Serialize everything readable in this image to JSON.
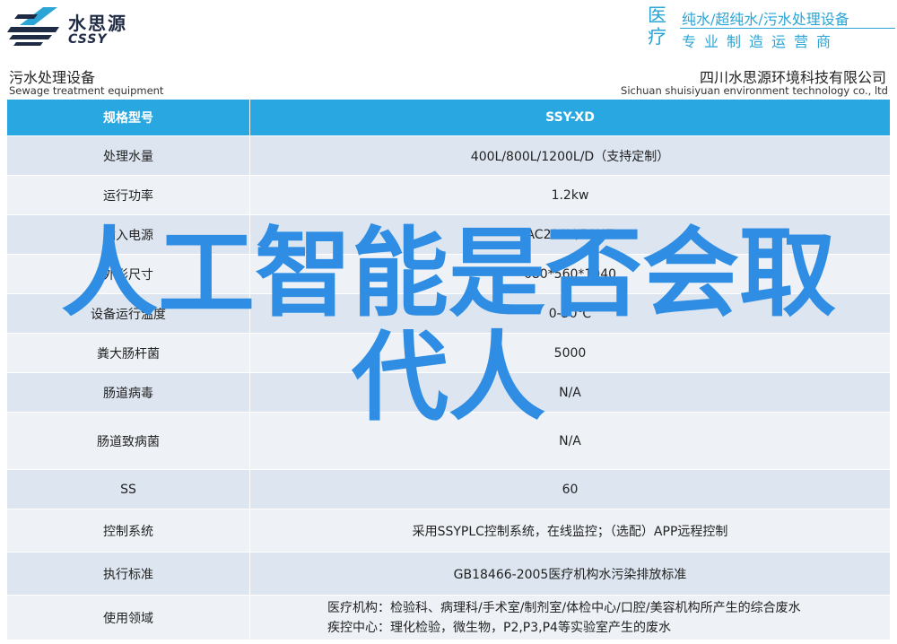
{
  "brand": {
    "name_cn": "水思源",
    "name_en": "CSSY"
  },
  "tagline": {
    "big_chars": "医疗",
    "line1": "纯水/超纯水/污水处理设备",
    "line2": "专业制造运营商"
  },
  "section": {
    "title_cn": "污水处理设备",
    "title_en": "Sewage treatment equipment",
    "company_cn": "四川水思源环境科技有限公司",
    "company_en": "Sichuan shuisiyuan environment technology co., ltd"
  },
  "table": {
    "header": {
      "key": "规格型号",
      "value": "SSY-XD"
    },
    "rows": [
      {
        "key": "处理水量",
        "value": "400L/800L/1200L/D（支持定制）"
      },
      {
        "key": "运行功率",
        "value": "1.2kw"
      },
      {
        "key": "输入电源",
        "value": "AC220V/50HZ"
      },
      {
        "key": "外形尺寸",
        "value": "680*560*1040"
      },
      {
        "key": "设备运行温度",
        "value": "0-50℃"
      },
      {
        "key": "粪大肠杆菌",
        "value": "5000"
      },
      {
        "key": "肠道病毒",
        "value": "N/A"
      },
      {
        "key": "肠道致病菌",
        "value": "N/A"
      },
      {
        "key": "SS",
        "value": "60"
      },
      {
        "key": "控制系统",
        "value": "采用SSYPLC控制系统，在线监控；（选配）APP远程控制"
      },
      {
        "key": "执行标准",
        "value": "GB18466-2005医疗机构水污染排放标准"
      },
      {
        "key": "使用领域",
        "value_line1": "医疗机构：检验科、病理科/手术室/制剂室/体检中心/口腔/美容机构所产生的综合废水",
        "value_line2": "疾控中心：理化检验，微生物，P2,P3,P4等实验室产生的废水"
      }
    ]
  },
  "overlay": {
    "line1": "人工智能是否会取",
    "line2": "代人"
  },
  "colors": {
    "accent": "#29a7e1",
    "headline": "#2f8ee3",
    "row_odd": "#dde6f0",
    "row_even": "#eef2f7"
  }
}
